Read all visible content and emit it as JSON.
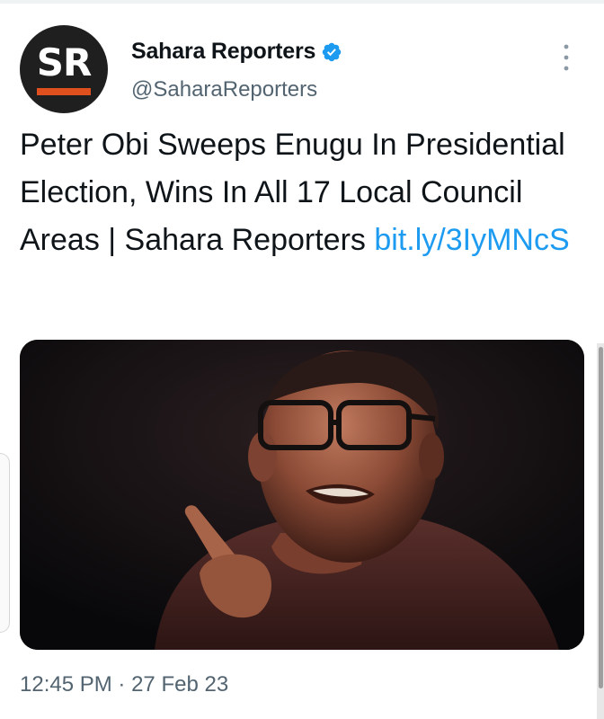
{
  "tweet": {
    "author": {
      "display_name": "Sahara Reporters",
      "handle": "@SaharaReporters",
      "avatar_text": "SR",
      "verified": true
    },
    "text": "Peter Obi Sweeps Enugu In Presidential Election, Wins In All 17 Local Council Areas | Sahara Reporters ",
    "link": "bit.ly/3IyMNcS",
    "time": "12:45 PM",
    "separator": "·",
    "date": "27 Feb 23",
    "media": {
      "description_icon": "photo-icon"
    }
  },
  "colors": {
    "link": "#1d9bf0",
    "verified_badge": "#1d9bf0",
    "secondary_text": "#536471",
    "avatar_background": "#1f1f1f",
    "avatar_accent": "#e0501f"
  },
  "icons": {
    "verified": "verified-badge-icon",
    "more": "more-vertical-icon"
  }
}
